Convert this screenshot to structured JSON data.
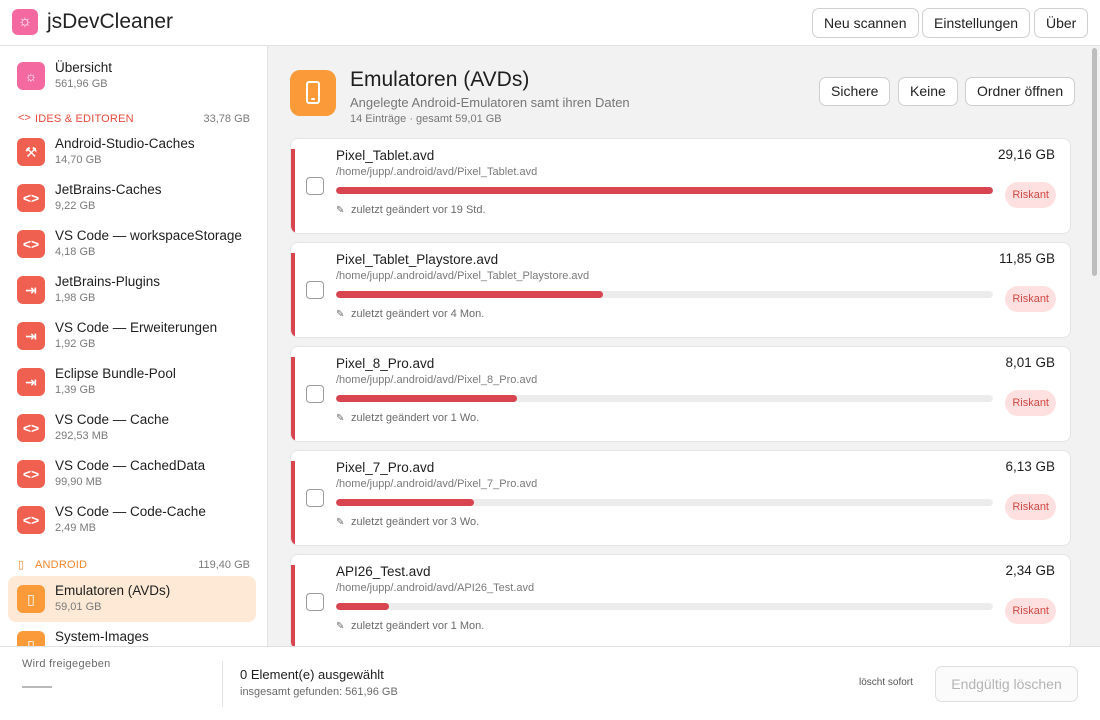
{
  "app": {
    "title": "jsDevCleaner",
    "logo_icon": "☼"
  },
  "header": {
    "rescan_label": "Neu scannen",
    "settings_label": "Einstellungen",
    "about_label": "Über"
  },
  "sidebar": {
    "overview": {
      "name": "Übersicht",
      "size": "561,96 GB",
      "icon": "☼"
    },
    "groups": [
      {
        "label": "IDEs & Editoren",
        "size": "33,78 GB",
        "icon": "<>",
        "items": [
          {
            "name": "Android-Studio-Caches",
            "size": "14,70 GB",
            "icon": "wrench"
          },
          {
            "name": "JetBrains-Caches",
            "size": "9,22 GB",
            "icon": "code"
          },
          {
            "name": "VS Code — workspaceStorage",
            "size": "4,18 GB",
            "icon": "code"
          },
          {
            "name": "JetBrains-Plugins",
            "size": "1,98 GB",
            "icon": "plug"
          },
          {
            "name": "VS Code — Erweiterungen",
            "size": "1,92 GB",
            "icon": "plug"
          },
          {
            "name": "Eclipse Bundle-Pool",
            "size": "1,39 GB",
            "icon": "plug"
          },
          {
            "name": "VS Code — Cache",
            "size": "292,53 MB",
            "icon": "code"
          },
          {
            "name": "VS Code — CachedData",
            "size": "99,90 MB",
            "icon": "code"
          },
          {
            "name": "VS Code — Code-Cache",
            "size": "2,49 MB",
            "icon": "code"
          }
        ]
      },
      {
        "label": "Android",
        "size": "119,40 GB",
        "icon": "phone",
        "items": [
          {
            "name": "Emulatoren (AVDs)",
            "size": "59,01 GB",
            "icon": "phone",
            "active": true
          },
          {
            "name": "System-Images",
            "size": "",
            "icon": "phone"
          }
        ]
      }
    ]
  },
  "category": {
    "title": "Emulatoren (AVDs)",
    "subtitle": "Angelegte Android-Emulatoren samt ihren Daten",
    "meta": "14 Einträge · gesamt 59,01 GB",
    "safe_label": "Sichere",
    "none_label": "Keine",
    "open_folder_label": "Ordner öffnen"
  },
  "entries": [
    {
      "name": "Pixel_Tablet.avd",
      "path": "/home/jupp/.android/avd/Pixel_Tablet.avd",
      "size": "29,16 GB",
      "fraction": 1.0,
      "modified": "zuletzt geändert vor 19 Std.",
      "risk": "Riskant"
    },
    {
      "name": "Pixel_Tablet_Playstore.avd",
      "path": "/home/jupp/.android/avd/Pixel_Tablet_Playstore.avd",
      "size": "11,85 GB",
      "fraction": 0.406,
      "modified": "zuletzt geändert vor 4 Mon.",
      "risk": "Riskant"
    },
    {
      "name": "Pixel_8_Pro.avd",
      "path": "/home/jupp/.android/avd/Pixel_8_Pro.avd",
      "size": "8,01 GB",
      "fraction": 0.275,
      "modified": "zuletzt geändert vor 1 Wo.",
      "risk": "Riskant"
    },
    {
      "name": "Pixel_7_Pro.avd",
      "path": "/home/jupp/.android/avd/Pixel_7_Pro.avd",
      "size": "6,13 GB",
      "fraction": 0.21,
      "modified": "zuletzt geändert vor 3 Wo.",
      "risk": "Riskant"
    },
    {
      "name": "API26_Test.avd",
      "path": "/home/jupp/.android/avd/API26_Test.avd",
      "size": "2,34 GB",
      "fraction": 0.08,
      "modified": "zuletzt geändert vor 1 Mon.",
      "risk": "Riskant"
    }
  ],
  "footer": {
    "release_label": "Wird freigegeben",
    "selected_text": "0 Element(e) ausgewählt",
    "found_text": "insgesamt gefunden: 561,96 GB",
    "mode_text": "löscht sofort",
    "delete_label": "Endgültig löschen"
  },
  "colors": {
    "accent_orange": "#fb9a39",
    "danger_red": "#d84450",
    "logo_pink": "#f46aa0",
    "active_bg": "#fde9d5"
  }
}
